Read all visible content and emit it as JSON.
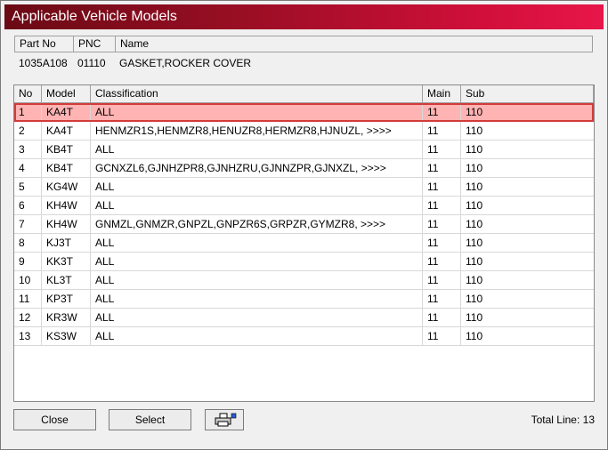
{
  "window": {
    "title": "Applicable Vehicle Models"
  },
  "part_header": {
    "part_no": "Part No",
    "pnc": "PNC",
    "name": "Name"
  },
  "part": {
    "part_no": "1035A108",
    "pnc": "01110",
    "name": "GASKET,ROCKER COVER"
  },
  "grid": {
    "columns": {
      "no": "No",
      "model": "Model",
      "classification": "Classification",
      "main": "Main",
      "sub": "Sub"
    },
    "rows": [
      {
        "no": "1",
        "model": "KA4T",
        "classification": "ALL",
        "main": "11",
        "sub": "110"
      },
      {
        "no": "2",
        "model": "KA4T",
        "classification": "HENMZR1S,HENMZR8,HENUZR8,HERMZR8,HJNUZL,  >>>>",
        "main": "11",
        "sub": "110"
      },
      {
        "no": "3",
        "model": "KB4T",
        "classification": "ALL",
        "main": "11",
        "sub": "110"
      },
      {
        "no": "4",
        "model": "KB4T",
        "classification": "GCNXZL6,GJNHZPR8,GJNHZRU,GJNNZPR,GJNXZL,  >>>>",
        "main": "11",
        "sub": "110"
      },
      {
        "no": "5",
        "model": "KG4W",
        "classification": "ALL",
        "main": "11",
        "sub": "110"
      },
      {
        "no": "6",
        "model": "KH4W",
        "classification": "ALL",
        "main": "11",
        "sub": "110"
      },
      {
        "no": "7",
        "model": "KH4W",
        "classification": "GNMZL,GNMZR,GNPZL,GNPZR6S,GRPZR,GYMZR8,  >>>>",
        "main": "11",
        "sub": "110"
      },
      {
        "no": "8",
        "model": "KJ3T",
        "classification": "ALL",
        "main": "11",
        "sub": "110"
      },
      {
        "no": "9",
        "model": "KK3T",
        "classification": "ALL",
        "main": "11",
        "sub": "110"
      },
      {
        "no": "10",
        "model": "KL3T",
        "classification": "ALL",
        "main": "11",
        "sub": "110"
      },
      {
        "no": "11",
        "model": "KP3T",
        "classification": "ALL",
        "main": "11",
        "sub": "110"
      },
      {
        "no": "12",
        "model": "KR3W",
        "classification": "ALL",
        "main": "11",
        "sub": "110"
      },
      {
        "no": "13",
        "model": "KS3W",
        "classification": "ALL",
        "main": "11",
        "sub": "110"
      }
    ],
    "selected_row": 1
  },
  "buttons": {
    "close": "Close",
    "select": "Select",
    "print_icon": "printer-icon"
  },
  "footer": {
    "total_line": "Total Line: 13"
  },
  "colors": {
    "title_start": "#6a0a14",
    "title_end": "#e8164a",
    "selection_fill": "#ffb3b3",
    "selection_border": "#d43a3a"
  }
}
